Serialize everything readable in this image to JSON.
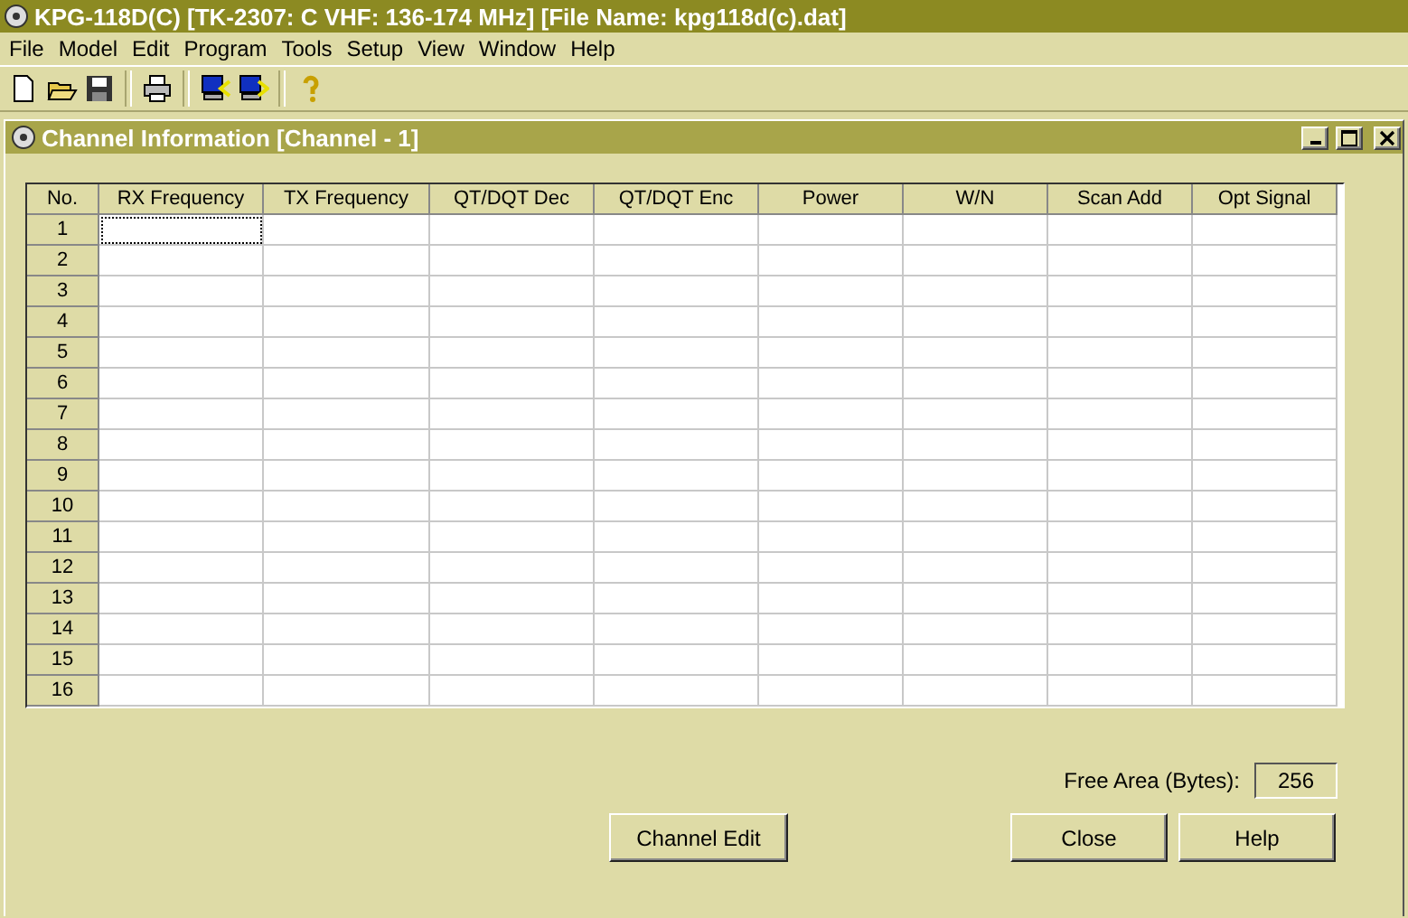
{
  "window": {
    "title": "KPG-118D(C) [TK-2307: C VHF: 136-174 MHz] [File Name: kpg118d(c).dat]"
  },
  "menu": [
    "File",
    "Model",
    "Edit",
    "Program",
    "Tools",
    "Setup",
    "View",
    "Window",
    "Help"
  ],
  "toolbar": [
    {
      "kind": "new"
    },
    {
      "kind": "open"
    },
    {
      "kind": "save"
    },
    {
      "kind": "sep"
    },
    {
      "kind": "print"
    },
    {
      "kind": "sep"
    },
    {
      "kind": "read"
    },
    {
      "kind": "write"
    },
    {
      "kind": "sep"
    },
    {
      "kind": "help"
    }
  ],
  "child_window": {
    "title": "Channel Information [Channel - 1]"
  },
  "table": {
    "columns": [
      "No.",
      "RX Frequency",
      "TX Frequency",
      "QT/DQT Dec",
      "QT/DQT Enc",
      "Power",
      "W/N",
      "Scan Add",
      "Opt Signal"
    ],
    "rows": [
      {
        "no": "1",
        "selected": true
      },
      {
        "no": "2",
        "selected": false
      },
      {
        "no": "3",
        "selected": false
      },
      {
        "no": "4",
        "selected": false
      },
      {
        "no": "5",
        "selected": false
      },
      {
        "no": "6",
        "selected": false
      },
      {
        "no": "7",
        "selected": false
      },
      {
        "no": "8",
        "selected": false
      },
      {
        "no": "9",
        "selected": false
      },
      {
        "no": "10",
        "selected": false
      },
      {
        "no": "11",
        "selected": false
      },
      {
        "no": "12",
        "selected": false
      },
      {
        "no": "13",
        "selected": false
      },
      {
        "no": "14",
        "selected": false
      },
      {
        "no": "15",
        "selected": false
      },
      {
        "no": "16",
        "selected": false
      }
    ]
  },
  "free_area": {
    "label": "Free Area (Bytes):",
    "value": "256"
  },
  "buttons": {
    "channel_edit": "Channel Edit",
    "close": "Close",
    "help": "Help"
  }
}
